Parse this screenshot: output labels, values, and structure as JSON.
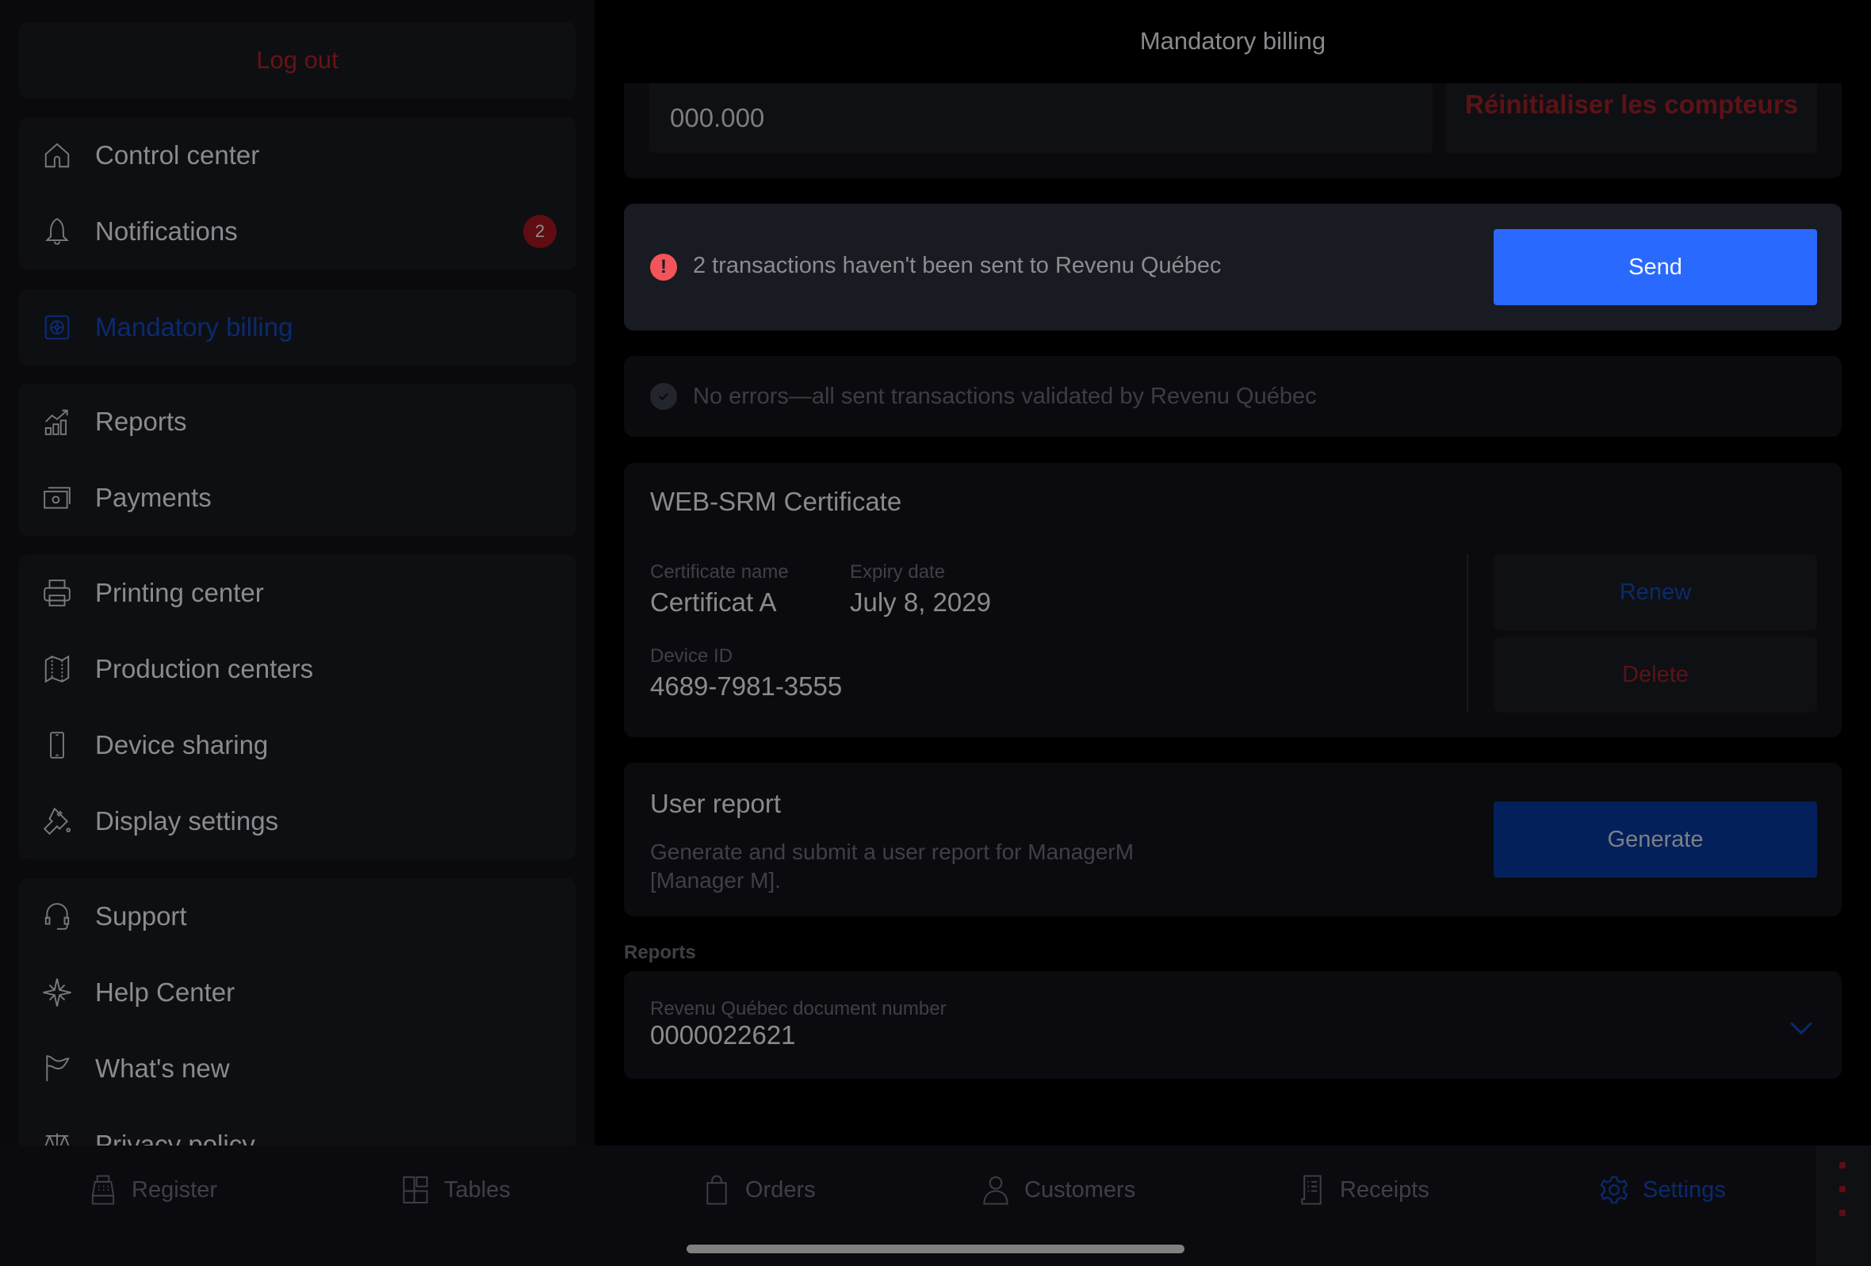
{
  "sidebar": {
    "logout_label": "Log out",
    "groups": [
      {
        "items": [
          {
            "label": "Control center",
            "icon": "house-icon"
          },
          {
            "label": "Notifications",
            "icon": "bell-icon",
            "badge": "2"
          }
        ]
      },
      {
        "items": [
          {
            "label": "Mandatory billing",
            "icon": "safe-icon",
            "active": true
          }
        ]
      },
      {
        "items": [
          {
            "label": "Reports",
            "icon": "chart-icon"
          },
          {
            "label": "Payments",
            "icon": "cash-icon"
          }
        ]
      },
      {
        "items": [
          {
            "label": "Printing center",
            "icon": "printer-icon"
          },
          {
            "label": "Production centers",
            "icon": "map-icon"
          },
          {
            "label": "Device sharing",
            "icon": "phone-icon"
          },
          {
            "label": "Display settings",
            "icon": "paint-bucket-icon"
          }
        ]
      },
      {
        "items": [
          {
            "label": "Support",
            "icon": "headset-icon"
          },
          {
            "label": "Help Center",
            "icon": "compass-star-icon"
          },
          {
            "label": "What's new",
            "icon": "flag-icon"
          },
          {
            "label": "Privacy policy",
            "icon": "scales-icon"
          }
        ]
      }
    ]
  },
  "header": {
    "title": "Mandatory billing"
  },
  "counter": {
    "value": "000.000",
    "reset_label": "Réinitialiser les compteurs"
  },
  "alert": {
    "text": "2 transactions haven't been sent to Revenu Québec",
    "send_label": "Send",
    "icon": "exclamation-icon"
  },
  "status": {
    "text": "No errors—all sent transactions validated by Revenu Québec",
    "icon": "check-circle-icon"
  },
  "certificate": {
    "title": "WEB-SRM Certificate",
    "name_label": "Certificate name",
    "name_value": "Certificat A",
    "expiry_label": "Expiry date",
    "expiry_value": "July 8, 2029",
    "device_label": "Device ID",
    "device_value": "4689-7981-3555",
    "renew_label": "Renew",
    "delete_label": "Delete"
  },
  "user_report": {
    "title": "User report",
    "description": "Generate and submit a user report for ManagerM [Manager M].",
    "generate_label": "Generate"
  },
  "reports": {
    "section_label": "Reports",
    "doc_label": "Revenu Québec document number",
    "doc_value": "0000022621"
  },
  "tabbar": {
    "tabs": [
      {
        "label": "Register",
        "icon": "cash-register-icon"
      },
      {
        "label": "Tables",
        "icon": "tables-icon"
      },
      {
        "label": "Orders",
        "icon": "bag-icon"
      },
      {
        "label": "Customers",
        "icon": "users-icon"
      },
      {
        "label": "Receipts",
        "icon": "receipt-icon"
      },
      {
        "label": "Settings",
        "icon": "gear-icon",
        "active": true
      }
    ]
  },
  "colors": {
    "accent_blue": "#2a69fe",
    "active_nav": "#0b2a6e",
    "danger": "#5c1216",
    "alert_red": "#f25459"
  }
}
